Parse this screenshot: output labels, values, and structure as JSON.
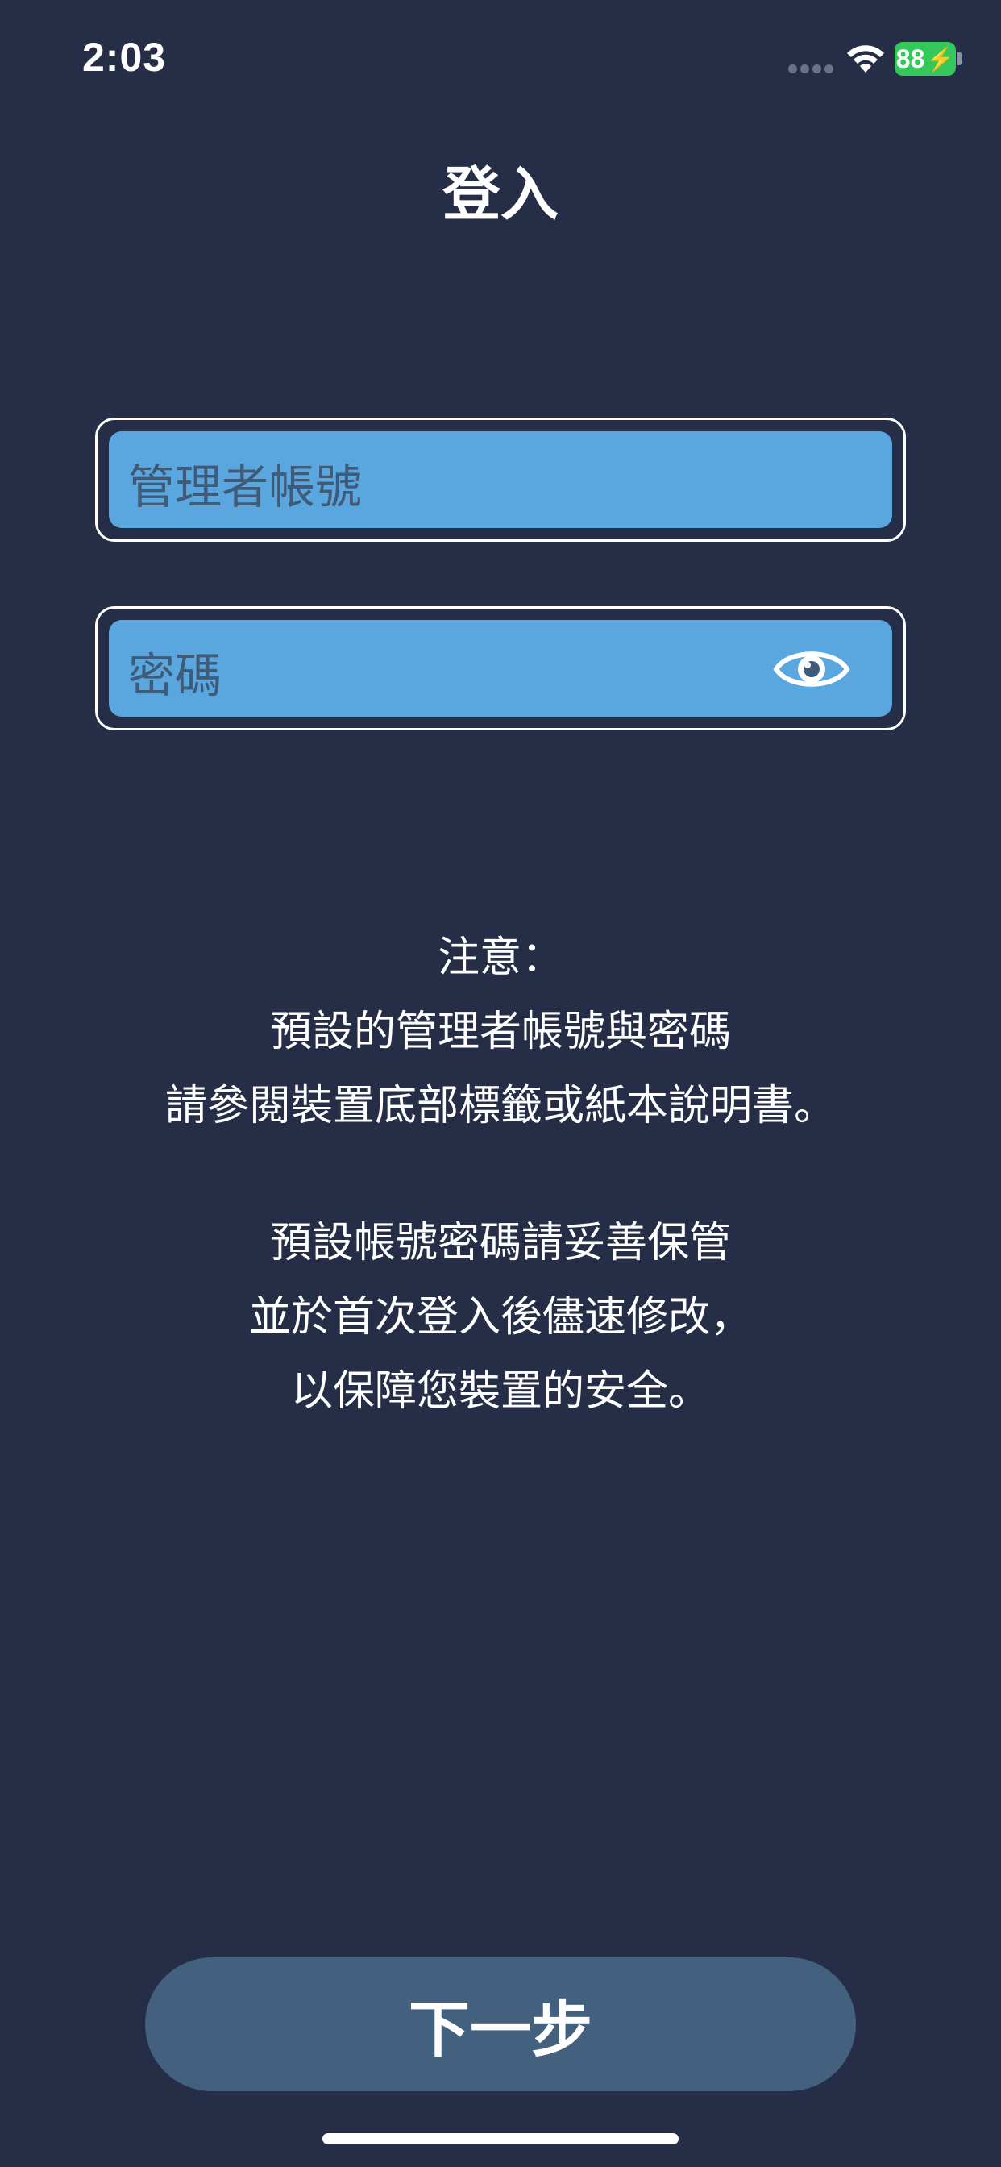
{
  "status_bar": {
    "time": "2:03",
    "battery_level": "88",
    "battery_charging": true,
    "icons": [
      "cellular-signal-icon",
      "wifi-icon",
      "battery-icon",
      "charging-bolt-icon"
    ]
  },
  "page": {
    "title": "登入"
  },
  "form": {
    "username_placeholder": "管理者帳號",
    "username_value": "",
    "password_placeholder": "密碼",
    "password_value": "",
    "password_toggle_icon": "eye-icon"
  },
  "notice": {
    "lines_block1": [
      "注意：",
      "預設的管理者帳號與密碼",
      "請參閱裝置底部標籤或紙本說明書。"
    ],
    "lines_block2": [
      "預設帳號密碼請妥善保管",
      "並於首次登入後儘速修改，",
      "以保障您裝置的安全。"
    ]
  },
  "actions": {
    "next_label": "下一步"
  },
  "colors": {
    "background": "#262e47",
    "input_fill": "#5aa7e0",
    "placeholder_text": "#3f5b78",
    "button_fill": "#44607f",
    "battery_green": "#34c759"
  }
}
